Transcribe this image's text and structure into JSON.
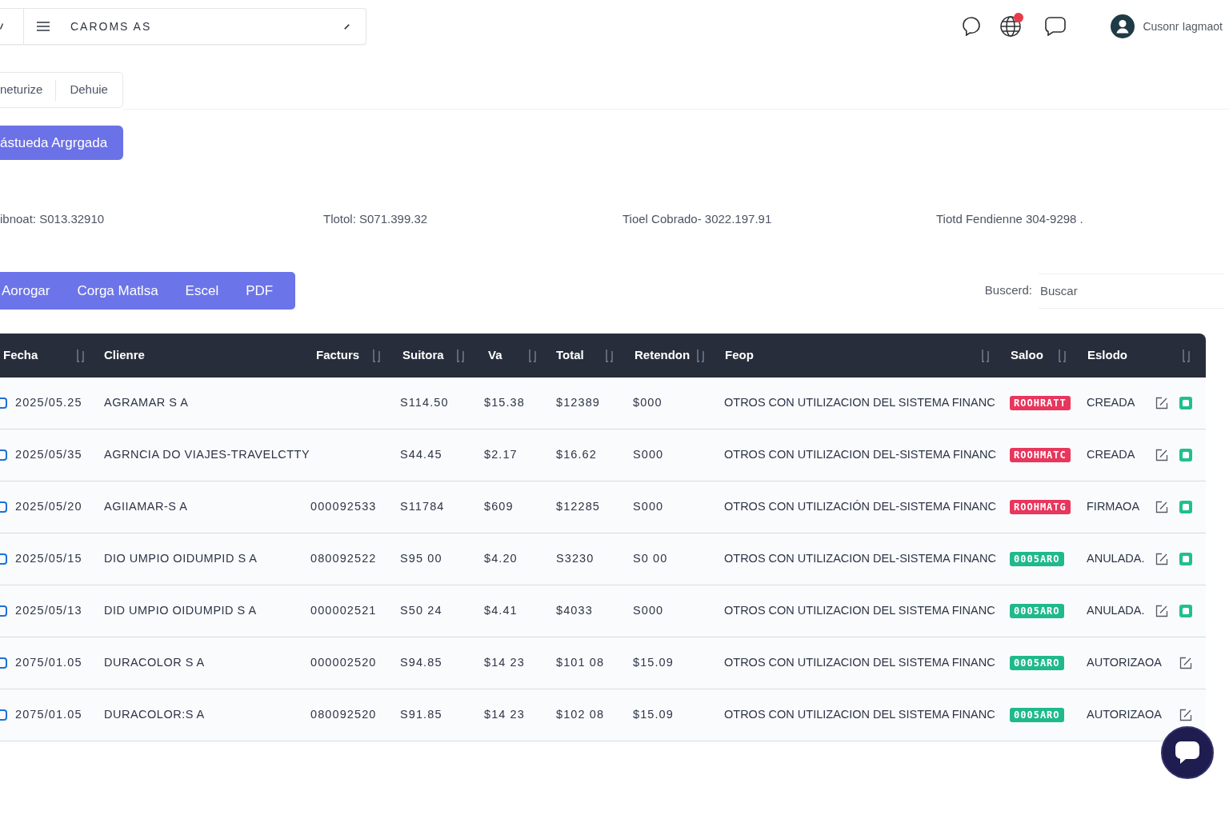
{
  "top_bar": {
    "title": "CAROMS AS"
  },
  "header_icons": [
    {
      "kind": "chat",
      "badge": false
    },
    {
      "kind": "globe",
      "badge": true
    },
    {
      "kind": "message",
      "badge": false
    }
  ],
  "user": {
    "name": "Cusonr Iagmaot"
  },
  "segments": [
    {
      "label": "neturize"
    },
    {
      "label": "Dehuie"
    }
  ],
  "primary_action": {
    "label": "ástueda Argrgada"
  },
  "summary": [
    "ibnoat: S013.32910",
    "Tlotol: S071.399.32",
    "Tioel Cobrado- 3022.197.91",
    "Tiotd Fendienne 304-9298 ."
  ],
  "toolbar": [
    "Aorogar",
    "Corga Matlsa",
    "Escel",
    "PDF"
  ],
  "search": {
    "label": "Buscerd:",
    "placeholder": "Buscar"
  },
  "table": {
    "columns": [
      {
        "label": "Fecha",
        "sortable": true
      },
      {
        "label": "Clienre",
        "sortable": false
      },
      {
        "label": "Facturs",
        "sortable": true
      },
      {
        "label": "Suitora",
        "sortable": true
      },
      {
        "label": "Va",
        "sortable": true
      },
      {
        "label": "Total",
        "sortable": true
      },
      {
        "label": "Retendon",
        "sortable": true
      },
      {
        "label": "Feop",
        "sortable": true
      },
      {
        "label": "Saloo",
        "sortable": true
      },
      {
        "label": "Eslodo",
        "sortable": true
      }
    ],
    "rows": [
      {
        "checked": false,
        "date": "2025/05.25",
        "client": "AGRAMAR S A",
        "subtotal": "S114.50",
        "tax": "$15.38",
        "total": "$12389",
        "retention": "$000",
        "payment_method": "OTROS CON UTILIZACION DEL SISTEMA FINANC",
        "balance": {
          "label": "ROOHRATT",
          "color": "#e8365d"
        },
        "status": "CREADA",
        "flagged": true
      },
      {
        "checked": false,
        "date": "2025/05/35",
        "client": "AGRNCIA DO VIAJES-TRAVELCTTY",
        "subtotal": "S44.45",
        "tax": "$2.17",
        "total": "$16.62",
        "retention": "S000",
        "payment_method": "OTROS CON UTILIZACION DEL-SISTEMA FINANC",
        "balance": {
          "label": "ROOHMATC",
          "color": "#e8365d"
        },
        "status": "CREADA",
        "flagged": true
      },
      {
        "checked": false,
        "date": "2025/05/20",
        "client": "AGIIAMAR-S A",
        "invoice": "000092533",
        "subtotal": "S11784",
        "tax": "$609",
        "total": "$12285",
        "retention": "S000",
        "payment_method": "OTROS CON UTILIZACIÓN DEL-SISTEMA FINANC",
        "balance": {
          "label": "ROOHMATG",
          "color": "#e8365d"
        },
        "status": "FIRMAOA",
        "flagged": true
      },
      {
        "checked": false,
        "date": "2025/05/15",
        "client": "DIO UMPIO OIDUMPID S A",
        "invoice": "080092522",
        "subtotal": "S95 00",
        "tax": "$4.20",
        "total": "S3230",
        "retention": "S0 00",
        "payment_method": "OTROS CON UTILIZACION DEL-SISTEMA FINANC",
        "balance": {
          "label": "0005ARO",
          "color": "#1fb98b"
        },
        "status": "ANULADA.",
        "flagged": true
      },
      {
        "checked": false,
        "date": "2025/05/13",
        "client": "DID UMPIO OIDUMPID S A",
        "invoice": "000002521",
        "subtotal": "S50 24",
        "tax": "$4.41",
        "total": "$4033",
        "retention": "S000",
        "payment_method": "OTROS CON UTILIZACION DEL SISTEMA FINANC",
        "balance": {
          "label": "0005ARO",
          "color": "#1fb98b"
        },
        "status": "ANULADA.",
        "flagged": true
      },
      {
        "checked": false,
        "date": "2075/01.05",
        "client": "DURACOLOR S A",
        "invoice": "000002520",
        "subtotal": "S94.85",
        "tax": "$14 23",
        "total": "$101 08",
        "retention": "$15.09",
        "payment_method": "OTROS CON UTILIZACION DEL SISTEMA FINANC",
        "balance": {
          "label": "0005ARO",
          "color": "#1fb98b"
        },
        "status": "AUTORIZAOA",
        "flagged": false
      },
      {
        "checked": false,
        "date": "2075/01.05",
        "client": "DURACOLOR:S A",
        "invoice": "080092520",
        "subtotal": "S91.85",
        "tax": "$14 23",
        "total": "$102 08",
        "retention": "$15.09",
        "payment_method": "OTROS CON UTILIZACION DEL SISTEMA FINANC",
        "balance": {
          "label": "0005ARO",
          "color": "#1fb98b"
        },
        "status": "AUTORIZAOA",
        "flagged": false
      }
    ]
  }
}
